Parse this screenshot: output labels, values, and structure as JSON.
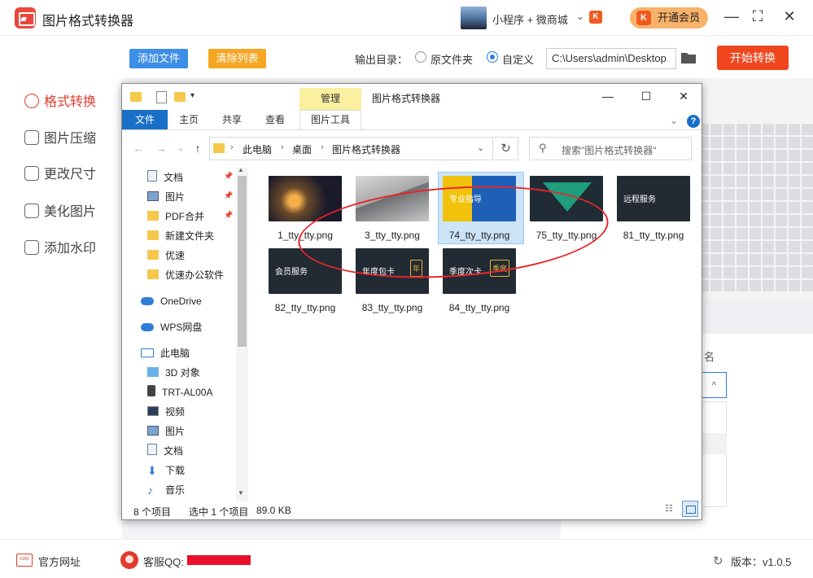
{
  "app": {
    "title": "图片格式转换器",
    "mini_program": "小程序 + 微商城",
    "mini_badge": "K",
    "vip_label": "开通会员",
    "vip_icon": "K"
  },
  "window_controls": {
    "minimize": "—",
    "maximize": "⛶",
    "close": "✕"
  },
  "toolbar": {
    "add_files": "添加文件",
    "clear_list": "清除列表",
    "output_label": "输出目录：",
    "radio_source": "原文件夹",
    "radio_custom": "自定义",
    "output_path": "C:\\Users\\admin\\Desktop",
    "start": "开始转换"
  },
  "sidebar": [
    {
      "label": "格式转换",
      "active": true
    },
    {
      "label": "图片压缩"
    },
    {
      "label": "更改尺寸"
    },
    {
      "label": "美化图片"
    },
    {
      "label": "添加水印"
    }
  ],
  "right_panel": {
    "rename_label": "名",
    "chevron": "^"
  },
  "footer": {
    "site": "官方网址",
    "qq": "客服QQ:",
    "version": "版本：v1.0.5",
    "site_icon": "com"
  },
  "explorer": {
    "title": "图片格式转换器",
    "ribbon": {
      "file": "文件",
      "home": "主页",
      "share": "共享",
      "view": "查看",
      "manage": "管理",
      "picture_tools": "图片工具"
    },
    "address": {
      "crumbs": [
        "此电脑",
        "桌面",
        "图片格式转换器"
      ],
      "search_placeholder": "搜索\"图片格式转换器\""
    },
    "nav": [
      {
        "label": "文档",
        "icon": "doc",
        "pinned": true
      },
      {
        "label": "图片",
        "icon": "pic",
        "pinned": true
      },
      {
        "label": "PDF合并",
        "icon": "fold",
        "pinned": true
      },
      {
        "label": "新建文件夹",
        "icon": "fold"
      },
      {
        "label": "优速",
        "icon": "fold"
      },
      {
        "label": "优速办公软件",
        "icon": "fold"
      },
      {
        "label": "OneDrive",
        "icon": "cloud"
      },
      {
        "label": "WPS网盘",
        "icon": "cloud"
      },
      {
        "label": "此电脑",
        "icon": "pc"
      },
      {
        "label": "3D 对象",
        "icon": "cube"
      },
      {
        "label": "TRT-AL00A",
        "icon": "phone"
      },
      {
        "label": "视频",
        "icon": "video"
      },
      {
        "label": "图片",
        "icon": "pic"
      },
      {
        "label": "文档",
        "icon": "doc"
      },
      {
        "label": "下载",
        "icon": "down"
      },
      {
        "label": "音乐",
        "icon": "music"
      }
    ],
    "files": [
      {
        "name": "1_tty_tty.png",
        "thumb_text": "",
        "selected": false
      },
      {
        "name": "3_tty_tty.png",
        "thumb_text": "",
        "selected": false
      },
      {
        "name": "74_tty_tty.png",
        "thumb_text": "专业指导",
        "selected": true
      },
      {
        "name": "75_tty_tty.png",
        "thumb_text": "",
        "selected": false
      },
      {
        "name": "81_tty_tty.png",
        "thumb_text": "远程服务",
        "selected": false
      },
      {
        "name": "82_tty_tty.png",
        "thumb_text": "会员服务",
        "selected": false
      },
      {
        "name": "83_tty_tty.png",
        "thumb_text": "年度包卡",
        "badge": "年",
        "selected": false
      },
      {
        "name": "84_tty_tty.png",
        "thumb_text": "季度次卡",
        "badge": "季度",
        "selected": false
      }
    ],
    "status": {
      "count": "8 个项目",
      "selected": "选中 1 个项目",
      "size": "89.0 KB"
    }
  },
  "colors": {
    "accent_blue": "#3c8ee6",
    "accent_orange": "#f5a623",
    "start_red": "#f0461e",
    "active_red": "#e03b2d",
    "annotation": "#e8262a"
  }
}
